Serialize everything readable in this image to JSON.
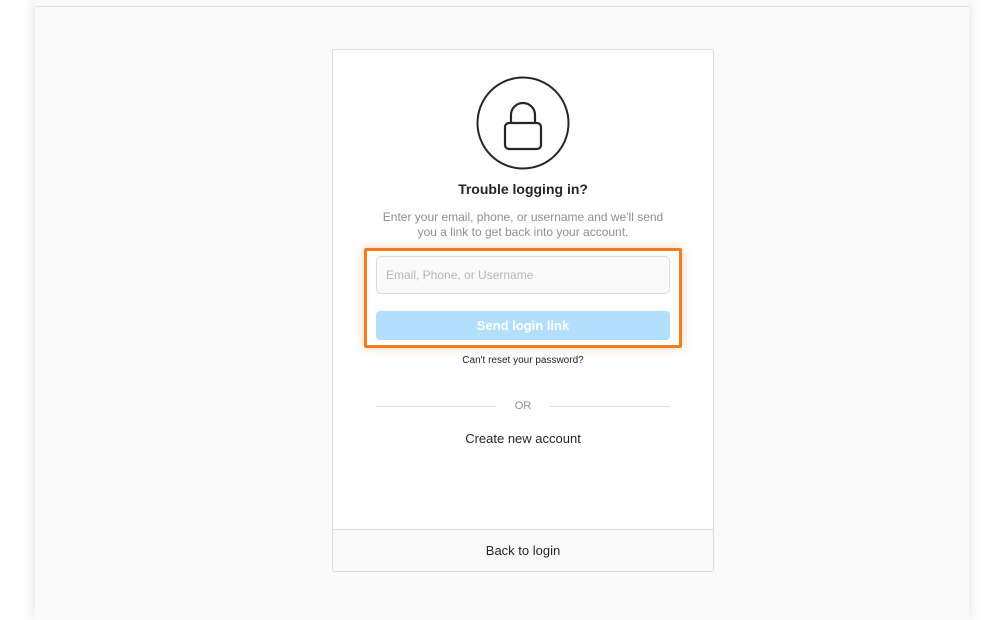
{
  "card": {
    "title": "Trouble logging in?",
    "description": "Enter your email, phone, or username and we'll send you a link to get back into your account.",
    "input": {
      "value": "",
      "placeholder": "Email, Phone, or Username"
    },
    "send_button_label": "Send login link",
    "reset_link": "Can't reset your password?",
    "divider_text": "OR",
    "create_account_link": "Create new account",
    "back_to_login": "Back to login",
    "icon": "lock-icon"
  },
  "colors": {
    "button_disabled": "#b2dffc",
    "highlight": "#f47b20",
    "border": "#dbdbdb",
    "muted_text": "#8e8e8e"
  }
}
